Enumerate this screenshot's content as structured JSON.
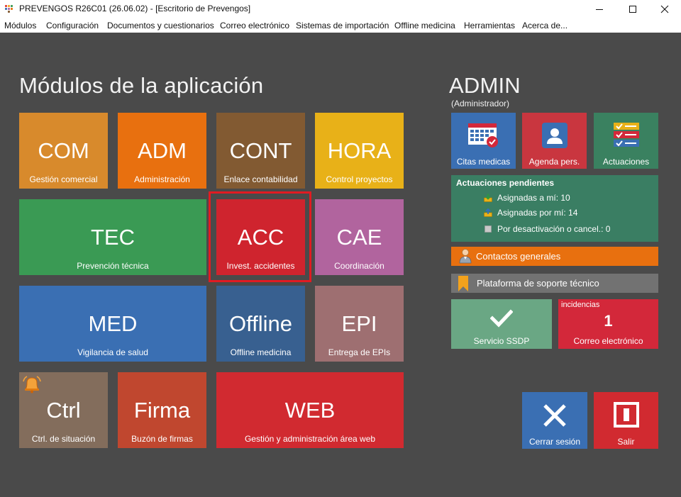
{
  "window": {
    "title": "PREVENGOS R26C01 (26.06.02) - [Escritorio de Prevengos]"
  },
  "menu": [
    "Módulos",
    "Configuración",
    "Documentos y cuestionarios",
    "Correo electrónico",
    "Sistemas de importación",
    "Offline medicina",
    "Herramientas",
    "Acerca de..."
  ],
  "modules_title": "Módulos de la aplicación",
  "modules": [
    {
      "code": "COM",
      "label": "Gestión comercial",
      "color": "#d88a2c"
    },
    {
      "code": "ADM",
      "label": "Administración",
      "color": "#e8700f"
    },
    {
      "code": "CONT",
      "label": "Enlace contabilidad",
      "color": "#825a32"
    },
    {
      "code": "HORA",
      "label": "Control proyectos",
      "color": "#e8b118"
    },
    {
      "code": "TEC",
      "label": "Prevención técnica",
      "color": "#3a9a54"
    },
    {
      "code": "ACC",
      "label": "Invest. accidentes",
      "color": "#cf242e"
    },
    {
      "code": "CAE",
      "label": "Coordinación",
      "color": "#b1649e"
    },
    {
      "code": "MED",
      "label": "Vigilancia de salud",
      "color": "#3a6fb3"
    },
    {
      "code": "Offline",
      "label": "Offline medicina",
      "color": "#386090"
    },
    {
      "code": "EPI",
      "label": "Entrega de EPIs",
      "color": "#9e6f71"
    },
    {
      "code": "Ctrl",
      "label": "Ctrl. de situación",
      "color": "#836d5c"
    },
    {
      "code": "Firma",
      "label": "Buzón de firmas",
      "color": "#c0472f"
    },
    {
      "code": "WEB",
      "label": "Gestión y administración área web",
      "color": "#d12a30"
    }
  ],
  "user": {
    "name": "ADMIN",
    "role": "(Administrador)"
  },
  "quick_tiles": [
    {
      "label": "Citas medicas",
      "color": "#3a6fb3",
      "icon": "calendar-icon"
    },
    {
      "label": "Agenda pers.",
      "color": "#c9363f",
      "icon": "contact-card-icon"
    },
    {
      "label": "Actuaciones",
      "color": "#3a8160",
      "icon": "checklist-icon"
    }
  ],
  "pending": {
    "title": "Actuaciones pendientes",
    "rows": [
      {
        "text": "Asignadas a mí: 10",
        "icon": "inbox-down-icon"
      },
      {
        "text": "Asignadas por mí: 14",
        "icon": "outbox-up-icon"
      },
      {
        "text": "Por desactivación o cancel.: 0",
        "icon": "square-icon"
      }
    ]
  },
  "contacts": {
    "label": "Contactos generales",
    "color": "#e8700f"
  },
  "support": {
    "label": "Plataforma de soporte técnico",
    "color": "#727272"
  },
  "ssdp": {
    "label": "Servicio SSDP"
  },
  "mail": {
    "badge": "incidencias",
    "count": "1",
    "label": "Correo electrónico"
  },
  "logout": {
    "label": "Cerrar sesión",
    "color": "#3a6fb3"
  },
  "exit": {
    "label": "Salir",
    "color": "#d12a30"
  }
}
